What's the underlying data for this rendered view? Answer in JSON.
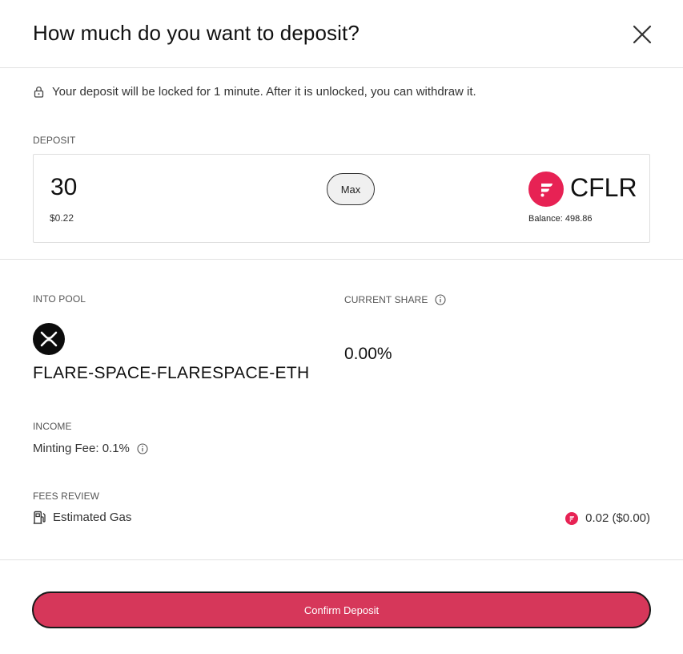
{
  "modal": {
    "title": "How much do you want to deposit?",
    "close_icon": "close-icon"
  },
  "notice": {
    "icon": "lock-icon",
    "text": "Your deposit will be locked for 1 minute. After it is unlocked, you can withdraw it."
  },
  "deposit": {
    "label": "DEPOSIT",
    "amount": "30",
    "usd_value": "$0.22",
    "max_label": "Max",
    "token": {
      "symbol": "CFLR",
      "icon": "flare-logo-icon",
      "color": "#e72254",
      "balance": "Balance: 498.86"
    }
  },
  "pool": {
    "label": "INTO POOL",
    "icon": "xrp-logo-icon",
    "name": "FLARE-SPACE-FLARESPACE-ETH"
  },
  "share": {
    "label": "CURRENT SHARE",
    "value": "0.00%"
  },
  "income": {
    "label": "INCOME",
    "minting_fee": "Minting Fee: 0.1%"
  },
  "fees": {
    "label": "FEES REVIEW",
    "gas_label": "Estimated Gas",
    "gas_icon": "gas-pump-icon",
    "gas_value": "0.02 ($0.00)"
  },
  "actions": {
    "confirm_label": "Confirm Deposit",
    "confirm_color": "#d6375a"
  }
}
